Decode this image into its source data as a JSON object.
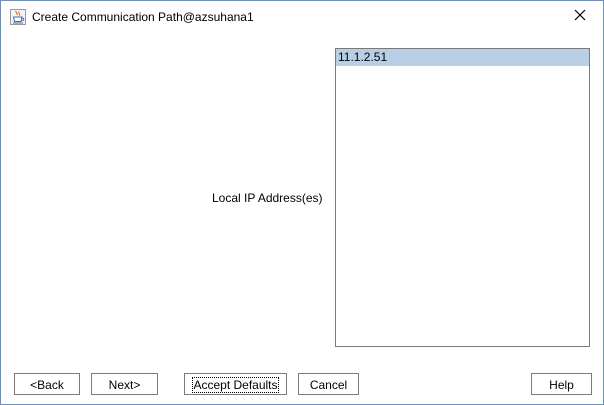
{
  "window": {
    "title": "Create Communication Path@azsuhana1",
    "app_icon": "java-cup-icon",
    "close_icon": "close-icon"
  },
  "form": {
    "local_ip_label": "Local IP Address(es)",
    "ip_addresses": [
      {
        "value": "11.1.2.51",
        "selected": true
      }
    ]
  },
  "buttons": {
    "back": "<Back",
    "next": "Next>",
    "accept_defaults": "Accept Defaults",
    "cancel": "Cancel",
    "help": "Help"
  },
  "colors": {
    "selection": "#b8cfe5",
    "window_border": "#6f8fb4",
    "control_border": "#7a7a7a"
  }
}
